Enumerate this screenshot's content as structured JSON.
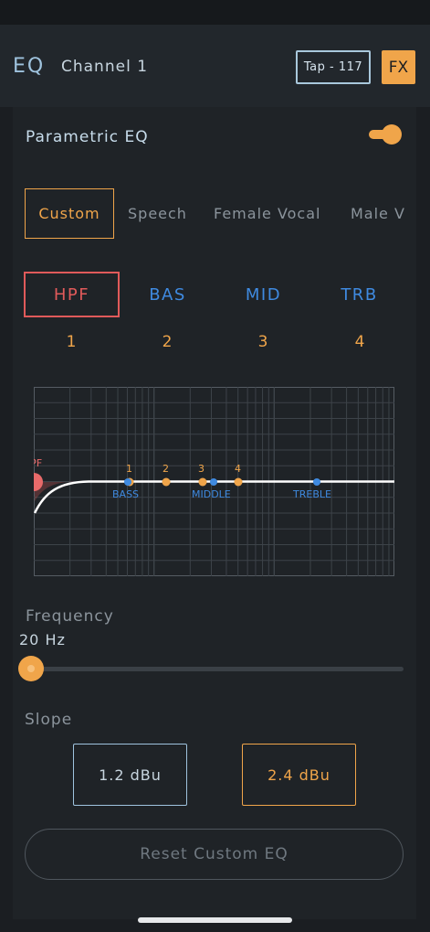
{
  "header": {
    "title": "EQ",
    "channel": "Channel 1",
    "tap_label": "Tap - 117",
    "fx_label": "FX"
  },
  "parametric_eq": {
    "label": "Parametric EQ",
    "enabled": true
  },
  "presets": {
    "selected": "Custom",
    "items": [
      "Custom",
      "Speech",
      "Female Vocal",
      "Male V"
    ]
  },
  "bands": {
    "selected": "HPF",
    "items": [
      {
        "label": "HPF",
        "number": "1"
      },
      {
        "label": "BAS",
        "number": "2"
      },
      {
        "label": "MID",
        "number": "3"
      },
      {
        "label": "TRB",
        "number": "4"
      }
    ]
  },
  "graph": {
    "hpf_label": "HPF",
    "point_labels": [
      "1",
      "2",
      "3",
      "4"
    ],
    "band_labels": [
      "BASS",
      "MIDDLE",
      "TREBLE"
    ]
  },
  "frequency": {
    "label": "Frequency",
    "value": "20 Hz",
    "slider_fraction": 0
  },
  "slope": {
    "label": "Slope",
    "options": [
      "1.2 dBu",
      "2.4 dBu"
    ],
    "selected": "2.4 dBu"
  },
  "reset_label": "Reset Custom EQ",
  "colors": {
    "accent": "#f0a54a",
    "hpf": "#e05a5a",
    "band": "#3f8ae0"
  }
}
